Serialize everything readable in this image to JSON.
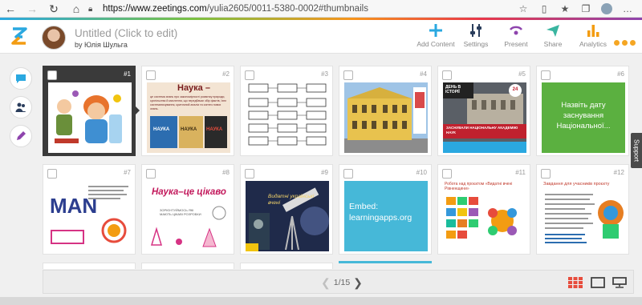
{
  "browser": {
    "url_host": "https://www.zeetings.com",
    "url_path": "/yulia2605/0011-5380-0002#thumbnails"
  },
  "header": {
    "title": "Untitled (Click to edit)",
    "author": "by Юлія Шульга",
    "tools": [
      {
        "label": "Add Content",
        "icon": "plus-icon",
        "color": "#2aa8e0"
      },
      {
        "label": "Settings",
        "icon": "sliders-icon",
        "color": "#2a3d5c"
      },
      {
        "label": "Present",
        "icon": "present-icon",
        "color": "#8e44ad"
      },
      {
        "label": "Share",
        "icon": "paper-plane-icon",
        "color": "#3ab5a0"
      },
      {
        "label": "Analytics",
        "icon": "bar-chart-icon",
        "color": "#f39c12"
      }
    ]
  },
  "support_label": "Support",
  "slides": [
    {
      "num": "#1",
      "selected": true
    },
    {
      "num": "#2",
      "title": "Наука –",
      "body": "це система знань про закономірності розвитку природи, суспільства й мислення, що передбачає збір фактів, їхнє систематизування, критичний аналіз та синтез нових знань.",
      "books": [
        "НАУКА",
        "НАУКА",
        "НАУКА"
      ]
    },
    {
      "num": "#3"
    },
    {
      "num": "#4"
    },
    {
      "num": "#5",
      "banner_top": "ДЕНЬ В ІСТОРІЇ",
      "banner_badge": "24",
      "banner_bottom": "ЗАСНУВАЛИ НАЦІОНАЛЬНУ АКАДЕМІЮ НАУК"
    },
    {
      "num": "#6",
      "text": "Назвіть дату заснування Національної..."
    },
    {
      "num": "#7"
    },
    {
      "num": "#8",
      "title": "Наука–це цікаво",
      "caption": "ЗОРІЄНТУЙМОСЬ ЯКІ МАЮТЬ ЦІКАВІ РОЗРОБКИ"
    },
    {
      "num": "#9",
      "title": "Видатні українські вчені"
    },
    {
      "num": "#10",
      "text": "Embed: learningapps.org"
    },
    {
      "num": "#11",
      "title": "Робота над проєктом «Видатні вчені Рівненщини»"
    },
    {
      "num": "#12",
      "title": "Завдання для учасників проєкту"
    }
  ],
  "pager": {
    "text": "1/15"
  }
}
